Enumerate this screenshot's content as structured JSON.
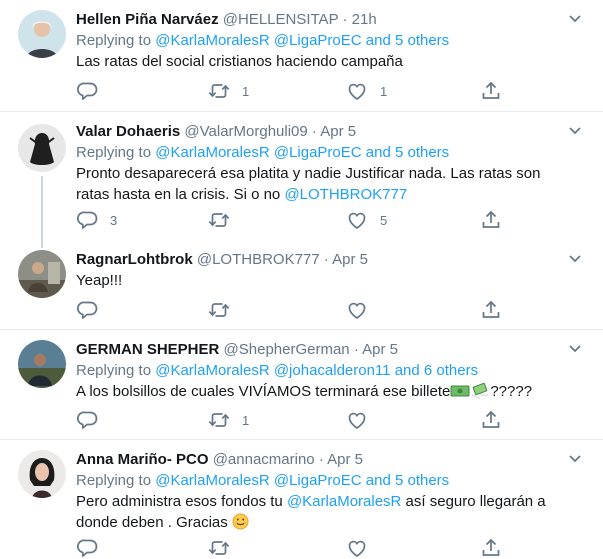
{
  "tweets": [
    {
      "name": "Hellen Piña Narváez",
      "handle": "@HELLENSITAP",
      "time": "21h",
      "replying_label": "Replying to",
      "reply_user1": "@KarlaMoralesR",
      "reply_user2": "@LigaProEC",
      "reply_others": "and 5 others",
      "text": "Las ratas del social cristianos haciendo campaña",
      "reply_count": "",
      "retweet_count": "1",
      "like_count": "1"
    },
    {
      "name": "Valar Dohaeris",
      "handle": "@ValarMorghuli09",
      "time": "Apr 5",
      "replying_label": "Replying to",
      "reply_user1": "@KarlaMoralesR",
      "reply_user2": "@LigaProEC",
      "reply_others": "and 5 others",
      "text": "Pronto desaparecerá esa platita y nadie Justificar nada. Las ratas son ratas hasta en la crisis. Si o no",
      "text_mention": "@LOTHBROK777",
      "reply_count": "3",
      "retweet_count": "",
      "like_count": "5"
    },
    {
      "name": "RagnarLohtbrok",
      "handle": "@LOTHBROK777",
      "time": "Apr 5",
      "text": "Yeap!!!",
      "reply_count": "",
      "retweet_count": "",
      "like_count": ""
    },
    {
      "name": "GERMAN SHEPHER",
      "handle": "@ShepherGerman",
      "time": "Apr 5",
      "replying_label": "Replying to",
      "reply_user1": "@KarlaMoralesR",
      "reply_user2": "@johacalderon11",
      "reply_others": "and 6 others",
      "text": "A los bolsillos de cuales VIVÍAMOS terminará ese billete",
      "text_after": "?????",
      "reply_count": "",
      "retweet_count": "1",
      "like_count": ""
    },
    {
      "name": "Anna Mariño- PCO",
      "handle": "@annacmarino",
      "time": "Apr 5",
      "replying_label": "Replying to",
      "reply_user1": "@KarlaMoralesR",
      "reply_user2": "@LigaProEC",
      "reply_others": "and 5 others",
      "text_before": "Pero administra esos fondos tu",
      "text_mention": "@KarlaMoralesR",
      "text_after": " así seguro llegarán a donde deben . Gracias"
    }
  ],
  "separator": "·",
  "icons": [
    "reply-icon",
    "retweet-icon",
    "like-icon",
    "share-icon",
    "chevron-down-icon",
    "money-emoji",
    "flying-money-emoji",
    "smiling-face-emoji"
  ],
  "colors": {
    "link": "#1da1f2",
    "muted": "#657786",
    "text": "#14171a",
    "divider": "#e6ecf0"
  }
}
